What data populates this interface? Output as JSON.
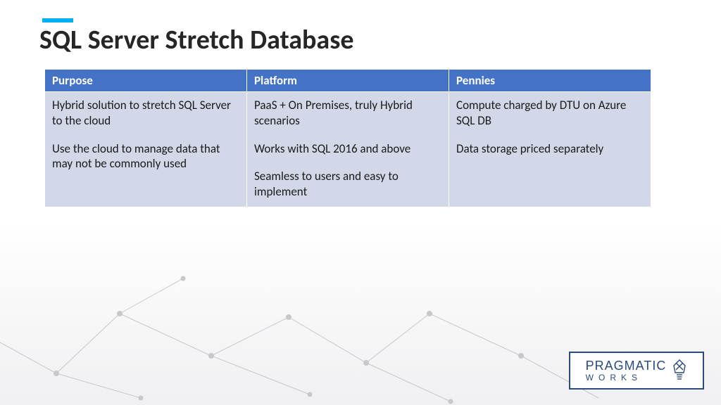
{
  "title": "SQL Server Stretch Database",
  "table": {
    "headers": [
      "Purpose",
      "Platform",
      "Pennies"
    ],
    "cells": {
      "purpose": [
        "Hybrid solution to stretch SQL Server to the cloud",
        "Use the cloud to manage data that may not be commonly used"
      ],
      "platform": [
        "PaaS + On Premises, truly Hybrid scenarios",
        "Works with SQL 2016 and above",
        "Seamless to users and easy to implement"
      ],
      "pennies": [
        "Compute charged by DTU on Azure SQL DB",
        "Data storage priced separately"
      ]
    }
  },
  "logo": {
    "line1": "PRAGMATIC",
    "line2": "WORKS"
  },
  "colors": {
    "accent": "#00b0f0",
    "tableHeader": "#4472c4",
    "tableBody": "#d2d8e8",
    "logo": "#2a4b7c"
  }
}
